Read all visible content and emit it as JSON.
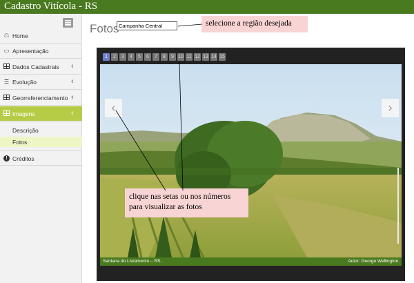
{
  "app": {
    "title": "Cadastro Vitícola - RS"
  },
  "sidebar": {
    "toggle_icon": "hamburger-icon",
    "items": [
      {
        "label": "Home",
        "icon": "home-icon",
        "has_submenu": false
      },
      {
        "label": "Apresentação",
        "icon": "monitor-icon",
        "has_submenu": false
      },
      {
        "label": "Dados Cadastrais",
        "icon": "table-icon",
        "has_submenu": true
      },
      {
        "label": "Evolução",
        "icon": "list-icon",
        "has_submenu": true
      },
      {
        "label": "Georreferenciamento",
        "icon": "table-icon",
        "has_submenu": true
      },
      {
        "label": "Imagens",
        "icon": "table-icon",
        "has_submenu": true,
        "active": true
      },
      {
        "label": "Créditos",
        "icon": "info-icon",
        "has_submenu": false
      }
    ],
    "subitems": [
      {
        "label": "Descrição"
      },
      {
        "label": "Fotos",
        "selected": true
      }
    ],
    "active_color": "#b7cc46"
  },
  "main": {
    "title": "Fotos",
    "region_select": {
      "value": "Campanha Central"
    },
    "callout_top": "selecione a região desejada",
    "callout_mid_line1": "clique nas setas ou nos números",
    "callout_mid_line2": "para visualizar as fotos",
    "gallery": {
      "pages": [
        "1",
        "2",
        "3",
        "4",
        "5",
        "6",
        "7",
        "8",
        "9",
        "10",
        "11",
        "12",
        "13",
        "14",
        "15"
      ],
      "current_page": "1",
      "prev_icon": "chevron-left-icon",
      "next_icon": "chevron-right-icon",
      "caption_location": "Santana do Livramento – RS.",
      "caption_author": "Autor: George Wellington."
    }
  },
  "colors": {
    "header": "#4a7a1f",
    "callout": "#f9d4d4",
    "current_page": "#6b7fc9"
  }
}
